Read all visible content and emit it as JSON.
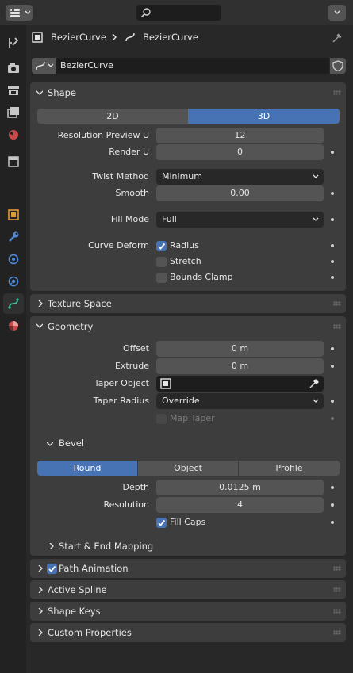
{
  "header": {
    "object_name": "BezierCurve",
    "data_name": "BezierCurve",
    "datablock_name": "BezierCurve"
  },
  "left_tabs": [
    {
      "name": "tool-icon"
    },
    {
      "name": "render-icon"
    },
    {
      "name": "output-icon"
    },
    {
      "name": "view-layer-icon"
    },
    {
      "name": "scene-icon"
    },
    {
      "name": "world-icon"
    },
    {
      "name": "object-icon"
    },
    {
      "name": "modifier-icon"
    },
    {
      "name": "particles-icon"
    },
    {
      "name": "physics-icon"
    },
    {
      "name": "curve-data-icon"
    },
    {
      "name": "material-icon"
    }
  ],
  "shape": {
    "title": "Shape",
    "dim_2d": "2D",
    "dim_3d": "3D",
    "active_dim": "3D",
    "resolution_preview_label": "Resolution Preview U",
    "resolution_preview_value": "12",
    "render_u_label": "Render U",
    "render_u_value": "0",
    "twist_method_label": "Twist Method",
    "twist_method_value": "Minimum",
    "smooth_label": "Smooth",
    "smooth_value": "0.00",
    "fill_mode_label": "Fill Mode",
    "fill_mode_value": "Full",
    "curve_deform_label": "Curve Deform",
    "radius_label": "Radius",
    "radius_checked": true,
    "stretch_label": "Stretch",
    "stretch_checked": false,
    "bounds_clamp_label": "Bounds Clamp",
    "bounds_clamp_checked": false
  },
  "texture_space": {
    "title": "Texture Space"
  },
  "geometry": {
    "title": "Geometry",
    "offset_label": "Offset",
    "offset_value": "0 m",
    "extrude_label": "Extrude",
    "extrude_value": "0 m",
    "taper_object_label": "Taper Object",
    "taper_radius_label": "Taper Radius",
    "taper_radius_value": "Override",
    "map_taper_label": "Map Taper",
    "map_taper_checked": false
  },
  "bevel": {
    "title": "Bevel",
    "modes": [
      "Round",
      "Object",
      "Profile"
    ],
    "active_mode": "Round",
    "depth_label": "Depth",
    "depth_value": "0.0125 m",
    "resolution_label": "Resolution",
    "resolution_value": "4",
    "fill_caps_label": "Fill Caps",
    "fill_caps_checked": true
  },
  "start_end_mapping": {
    "title": "Start & End Mapping"
  },
  "path_animation": {
    "title": "Path Animation",
    "checked": true
  },
  "active_spline": {
    "title": "Active Spline"
  },
  "shape_keys": {
    "title": "Shape Keys"
  },
  "custom_properties": {
    "title": "Custom Properties"
  },
  "colors": {
    "accent": "#4772b3",
    "panel": "#3d3d3d",
    "background": "#282828",
    "field": "#545454"
  }
}
